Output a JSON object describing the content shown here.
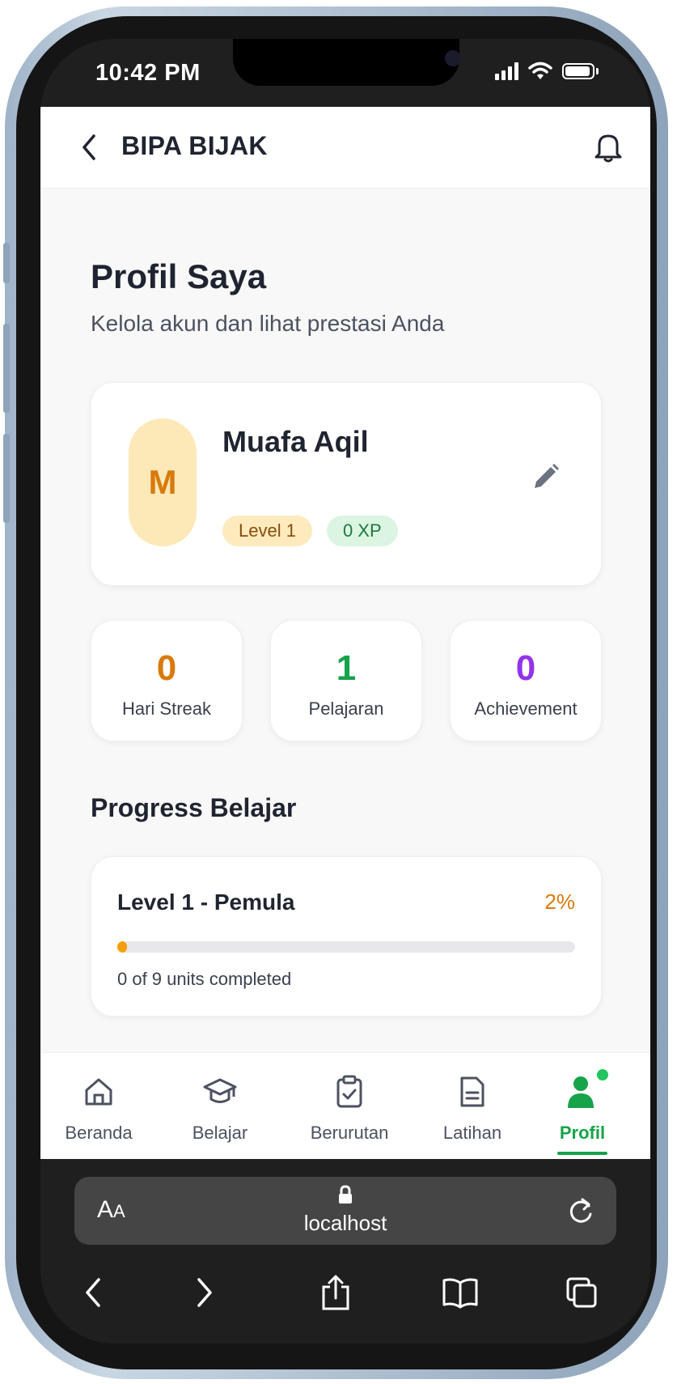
{
  "status_bar": {
    "time": "10:42 PM"
  },
  "header": {
    "title": "BIPA BIJAK"
  },
  "page": {
    "title": "Profil Saya",
    "subtitle": "Kelola akun dan lihat prestasi Anda"
  },
  "profile": {
    "initial": "M",
    "name": "Muafa Aqil",
    "level_badge": "Level 1",
    "xp_badge": "0 XP"
  },
  "stats": [
    {
      "value": "0",
      "label": "Hari Streak",
      "color": "#d97a0c"
    },
    {
      "value": "1",
      "label": "Pelajaran",
      "color": "#16a34a"
    },
    {
      "value": "0",
      "label": "Achievement",
      "color": "#9333ea"
    }
  ],
  "progress": {
    "section_title": "Progress Belajar",
    "level_label": "Level 1 - Pemula",
    "percent_label": "2%",
    "percent_value": 2,
    "units_note": "0 of 9 units completed"
  },
  "bottom_nav": {
    "items": [
      {
        "label": "Beranda",
        "icon": "home-icon"
      },
      {
        "label": "Belajar",
        "icon": "graduation-cap-icon"
      },
      {
        "label": "Berurutan",
        "icon": "clipboard-check-icon"
      },
      {
        "label": "Latihan",
        "icon": "document-icon"
      },
      {
        "label": "Profil",
        "icon": "user-icon",
        "active": true
      }
    ]
  },
  "browser": {
    "text_size_label_big": "A",
    "text_size_label_small": "A",
    "url": "localhost"
  },
  "colors": {
    "accent": "#16a34a",
    "orange": "#d97a0c",
    "purple": "#9333ea"
  }
}
